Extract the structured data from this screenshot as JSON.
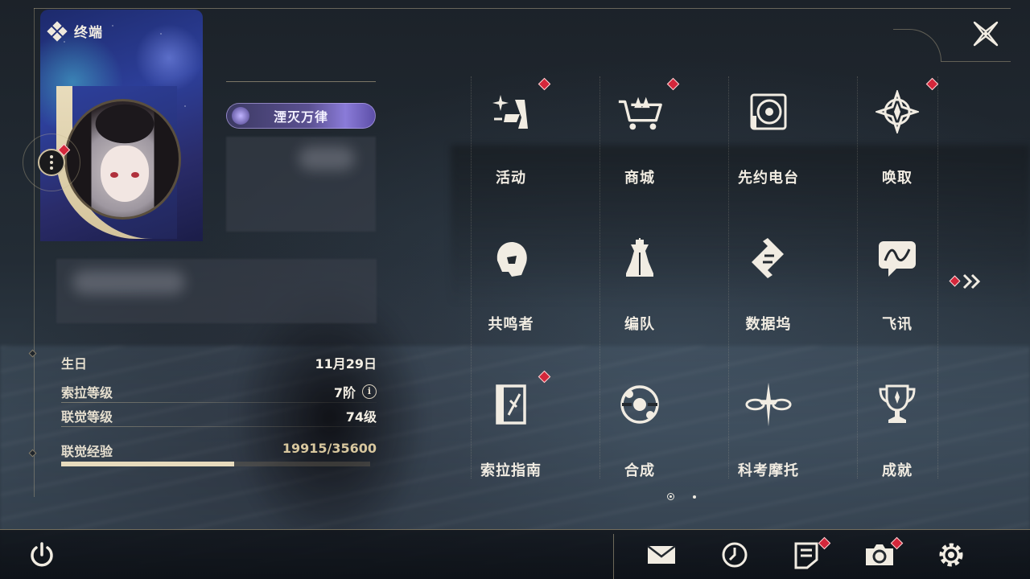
{
  "header": {
    "title": "终端",
    "icon": "terminal-diamonds-icon"
  },
  "profile": {
    "title_plate": "湮灭万律",
    "birthday_label": "生日",
    "birthday_value": "11月29日",
    "sola_level_label": "索拉等级",
    "sola_level_value": "7阶",
    "union_level_label": "联觉等级",
    "union_level_value": "74级",
    "union_exp_label": "联觉经验",
    "union_exp_value": "19915/35600",
    "union_exp_progress": 0.559
  },
  "menu": [
    {
      "label": "活动",
      "icon": "events-sparkle-icon",
      "badge": true
    },
    {
      "label": "商城",
      "icon": "shop-crown-cart-icon",
      "badge": true
    },
    {
      "label": "先约电台",
      "icon": "radio-vinyl-icon",
      "badge": false
    },
    {
      "label": "唤取",
      "icon": "convene-compass-icon",
      "badge": true
    },
    {
      "label": "共鸣者",
      "icon": "resonator-portrait-icon",
      "badge": false
    },
    {
      "label": "编队",
      "icon": "team-chess-icon",
      "badge": false
    },
    {
      "label": "数据坞",
      "icon": "data-bank-icon",
      "badge": false
    },
    {
      "label": "飞讯",
      "icon": "messages-chat-icon",
      "badge": false
    },
    {
      "label": "索拉指南",
      "icon": "guidebook-icon",
      "badge": true
    },
    {
      "label": "合成",
      "icon": "synthesis-orbit-icon",
      "badge": false
    },
    {
      "label": "科考摩托",
      "icon": "motorcycle-icon",
      "badge": false
    },
    {
      "label": "成就",
      "icon": "achievement-trophy-icon",
      "badge": false
    }
  ],
  "bottom_bar": [
    {
      "name": "mail",
      "icon": "mail-icon",
      "badge": false
    },
    {
      "name": "clock",
      "icon": "clock-icon",
      "badge": false
    },
    {
      "name": "notes",
      "icon": "notice-icon",
      "badge": true
    },
    {
      "name": "camera",
      "icon": "camera-icon",
      "badge": true
    },
    {
      "name": "settings",
      "icon": "gear-icon",
      "badge": false
    }
  ],
  "pagination": {
    "pages": 2,
    "current": 1
  },
  "colors": {
    "badge": "#d4273b",
    "accent": "#e7dbbd",
    "text": "#f1ece2",
    "frame": "#c8b996"
  }
}
